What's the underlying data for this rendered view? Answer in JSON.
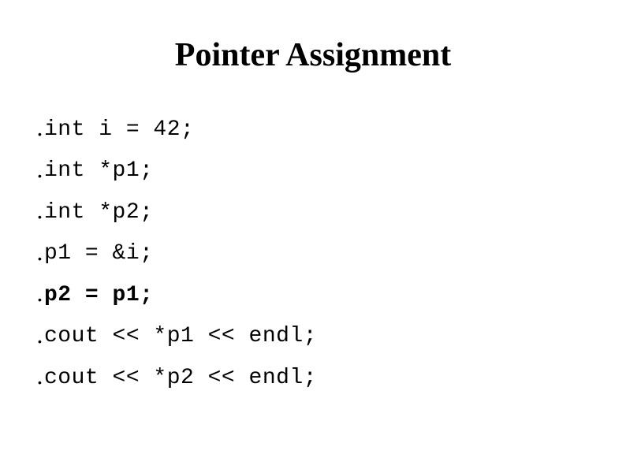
{
  "slide": {
    "title": "Pointer Assignment",
    "bullet_glyph": "•",
    "lines": [
      {
        "text": "int i = 42;",
        "bold": false
      },
      {
        "text": "int *p1;",
        "bold": false
      },
      {
        "text": "int *p2;",
        "bold": false
      },
      {
        "text": "p1 = &i;",
        "bold": false
      },
      {
        "text": "p2 = p1;",
        "bold": true
      },
      {
        "text": "cout << *p1 << endl;",
        "bold": false
      },
      {
        "text": "cout << *p2 << endl;",
        "bold": false
      }
    ]
  }
}
